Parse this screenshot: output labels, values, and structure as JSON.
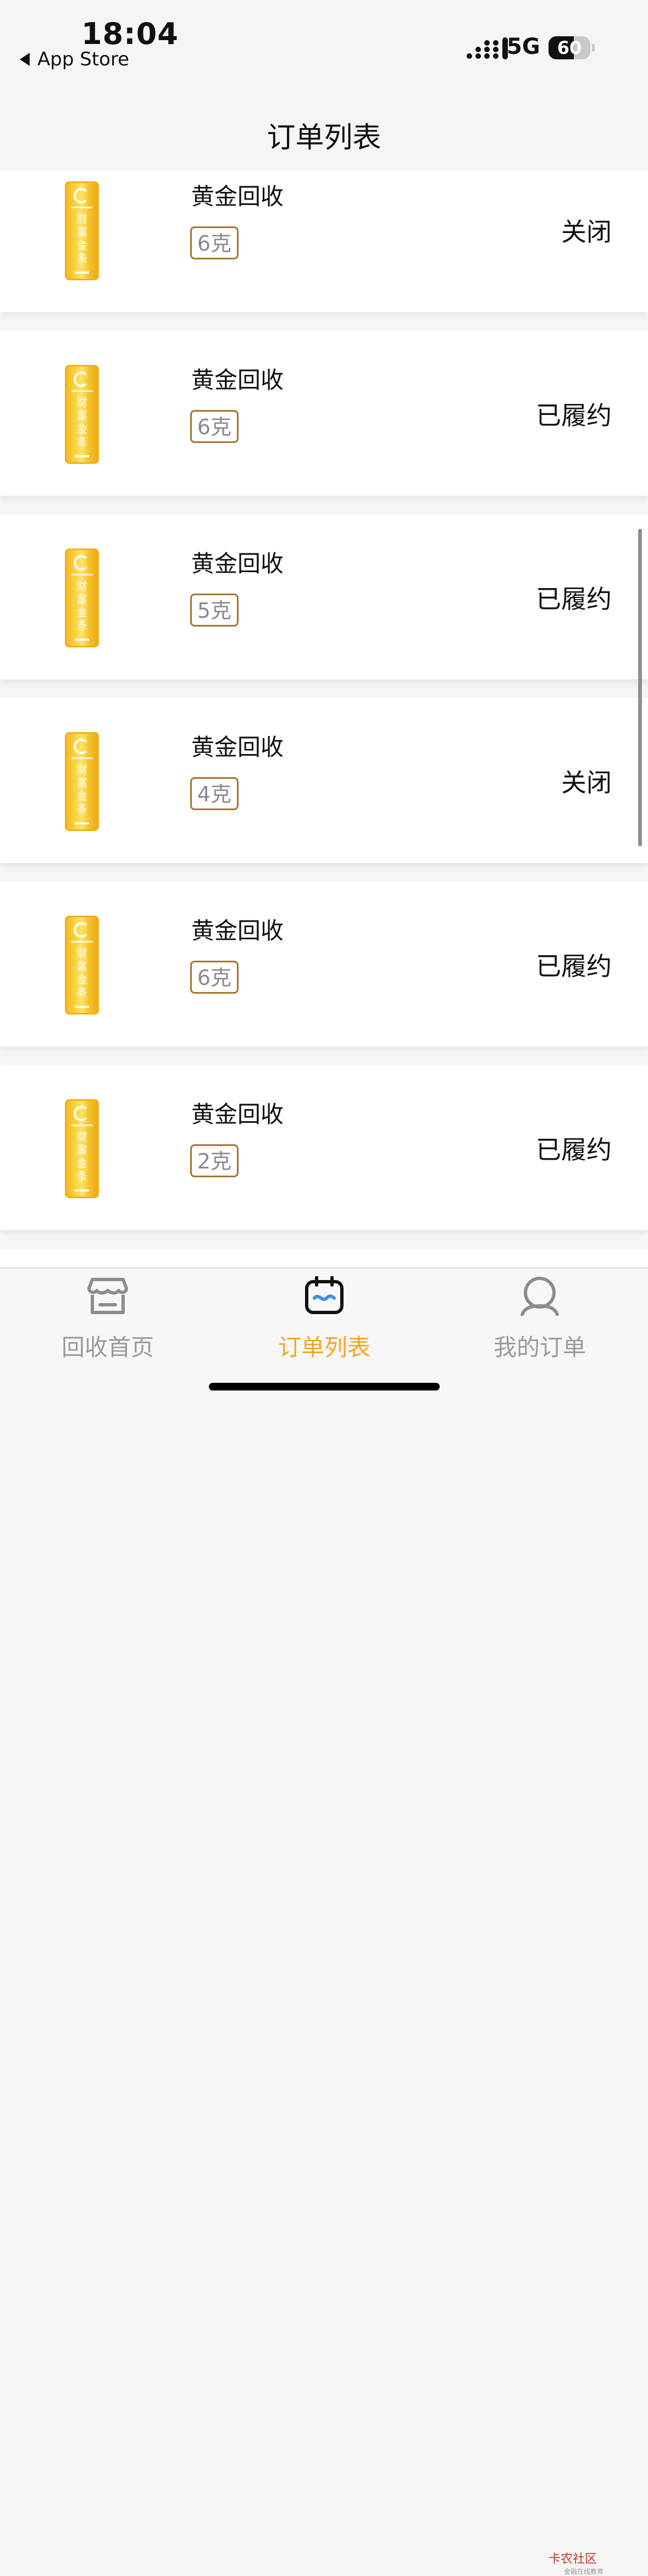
{
  "status_bar": {
    "time": "18:04",
    "back_label": "App Store",
    "network": "5G",
    "battery": "60",
    "battery_level": 0.6
  },
  "header": {
    "title": "订单列表"
  },
  "product_bar_text": "财富金条",
  "orders": [
    {
      "title": "黄金回收",
      "weight": "6克",
      "status": "关闭"
    },
    {
      "title": "黄金回收",
      "weight": "6克",
      "status": "已履约"
    },
    {
      "title": "黄金回收",
      "weight": "5克",
      "status": "已履约"
    },
    {
      "title": "黄金回收",
      "weight": "4克",
      "status": "关闭"
    },
    {
      "title": "黄金回收",
      "weight": "6克",
      "status": "已履约"
    },
    {
      "title": "黄金回收",
      "weight": "2克",
      "status": "已履约"
    }
  ],
  "tabs": [
    {
      "label": "回收首页",
      "icon": "storefront-icon",
      "active": false
    },
    {
      "label": "订单列表",
      "icon": "order-list-icon",
      "active": true
    },
    {
      "label": "我的订单",
      "icon": "user-icon",
      "active": false
    }
  ],
  "watermark": {
    "name": "卡农社区",
    "sub": "金融在线教育"
  },
  "colors": {
    "accent": "#f5a623",
    "gold": "#f8c933",
    "weight_border": "#a8732c"
  }
}
